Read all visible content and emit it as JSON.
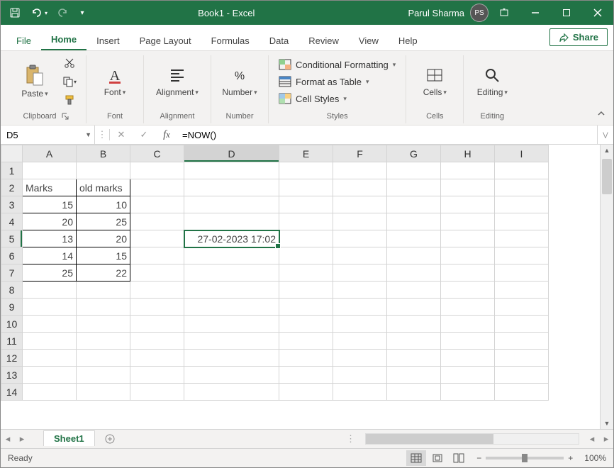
{
  "titlebar": {
    "doc_title": "Book1  -  Excel",
    "user_name": "Parul Sharma",
    "user_initials": "PS"
  },
  "tabs": {
    "file": "File",
    "items": [
      "Home",
      "Insert",
      "Page Layout",
      "Formulas",
      "Data",
      "Review",
      "View",
      "Help"
    ],
    "active": "Home",
    "share": "Share"
  },
  "ribbon": {
    "clipboard": {
      "paste": "Paste",
      "label": "Clipboard"
    },
    "font": {
      "btn": "Font",
      "label": "Font"
    },
    "alignment": {
      "btn": "Alignment",
      "label": "Alignment"
    },
    "number": {
      "btn": "Number",
      "label": "Number"
    },
    "styles": {
      "cond": "Conditional Formatting",
      "fat": "Format as Table",
      "cell": "Cell Styles",
      "label": "Styles"
    },
    "cells": {
      "btn": "Cells",
      "label": "Cells"
    },
    "editing": {
      "btn": "Editing",
      "label": "Editing"
    }
  },
  "formula_bar": {
    "name_box": "D5",
    "formula": "=NOW()"
  },
  "grid": {
    "columns": [
      "A",
      "B",
      "C",
      "D",
      "E",
      "F",
      "G",
      "H",
      "I"
    ],
    "selected_col": "D",
    "selected_row": 5,
    "rows": [
      {
        "r": 1
      },
      {
        "r": 2,
        "A": "Marks",
        "B": "old marks",
        "A_text": true,
        "B_text": true
      },
      {
        "r": 3,
        "A": "15",
        "B": "10"
      },
      {
        "r": 4,
        "A": "20",
        "B": "25"
      },
      {
        "r": 5,
        "A": "13",
        "B": "20",
        "D": "27-02-2023 17:02"
      },
      {
        "r": 6,
        "A": "14",
        "B": "15"
      },
      {
        "r": 7,
        "A": "25",
        "B": "22"
      },
      {
        "r": 8
      },
      {
        "r": 9
      },
      {
        "r": 10
      },
      {
        "r": 11
      },
      {
        "r": 12
      },
      {
        "r": 13
      },
      {
        "r": 14
      }
    ]
  },
  "sheet_tabs": {
    "active": "Sheet1"
  },
  "status": {
    "ready": "Ready",
    "zoom": "100%"
  }
}
